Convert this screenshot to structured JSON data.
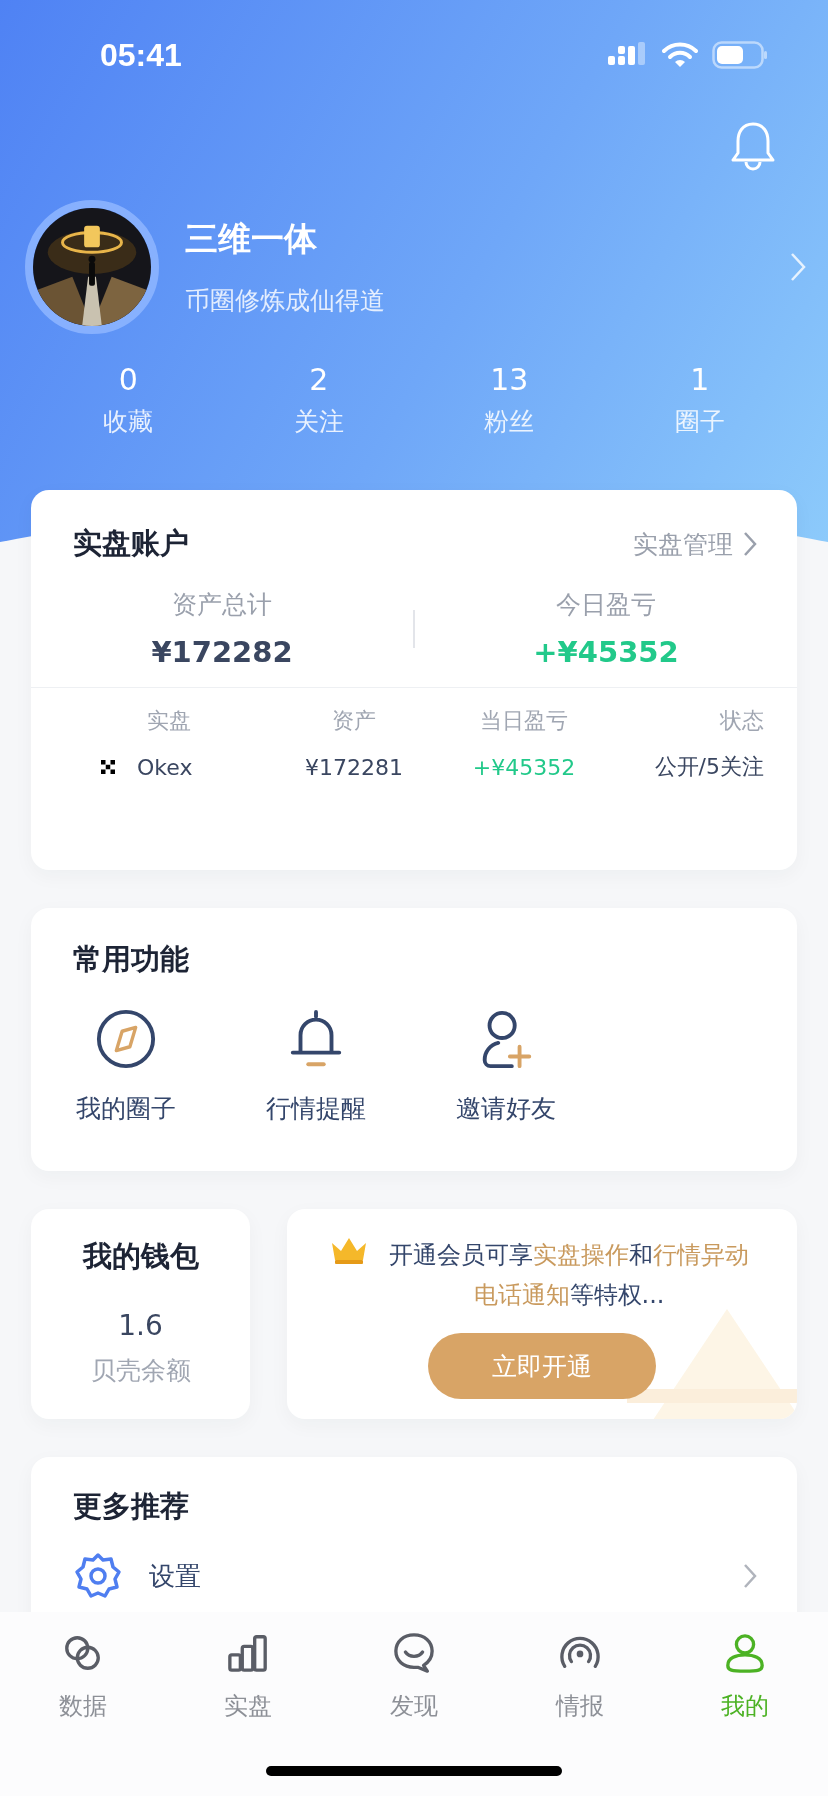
{
  "status_bar": {
    "time": "05:41"
  },
  "profile": {
    "name": "三维一体",
    "bio": "币圈修炼成仙得道"
  },
  "stats": [
    {
      "value": "0",
      "label": "收藏"
    },
    {
      "value": "2",
      "label": "关注"
    },
    {
      "value": "13",
      "label": "粉丝"
    },
    {
      "value": "1",
      "label": "圈子"
    }
  ],
  "account": {
    "title": "实盘账户",
    "link": "实盘管理",
    "totals": [
      {
        "label": "资产总计",
        "value": "¥172282",
        "positive": false
      },
      {
        "label": "今日盈亏",
        "value": "+¥45352",
        "positive": true
      }
    ],
    "columns": [
      "实盘",
      "资产",
      "当日盈亏",
      "状态"
    ],
    "rows": [
      {
        "name": "Okex",
        "assets": "¥172281",
        "pnl": "+¥45352",
        "status": "公开/5关注"
      }
    ]
  },
  "functions": {
    "title": "常用功能",
    "items": [
      {
        "kind": "circle",
        "label": "我的圈子"
      },
      {
        "kind": "alert",
        "label": "行情提醒"
      },
      {
        "kind": "invite",
        "label": "邀请好友"
      }
    ]
  },
  "wallet": {
    "title": "我的钱包",
    "value": "1.6",
    "label": "贝壳余额"
  },
  "membership": {
    "text": [
      {
        "text": "开通会员可享",
        "highlight": false
      },
      {
        "text": "实盘操作",
        "highlight": true
      },
      {
        "text": "和",
        "highlight": false
      },
      {
        "text": "行情异动电话通知",
        "highlight": true
      },
      {
        "text": "等特权...",
        "highlight": false
      }
    ],
    "button": "立即开通"
  },
  "more": {
    "title": "更多推荐",
    "items": [
      {
        "label": "设置"
      }
    ]
  },
  "tabs": [
    {
      "label": "数据",
      "kind": "circles",
      "selected": false
    },
    {
      "label": "实盘",
      "kind": "bars",
      "selected": false
    },
    {
      "label": "发现",
      "kind": "chat",
      "selected": false
    },
    {
      "label": "情报",
      "kind": "signal",
      "selected": false
    },
    {
      "label": "我的",
      "kind": "person",
      "selected": true
    }
  ]
}
